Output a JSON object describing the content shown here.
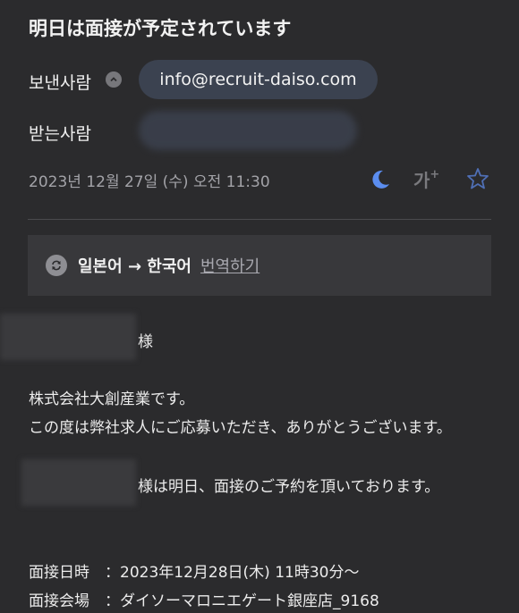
{
  "email": {
    "subject": "明日は面接が予定されています",
    "from_label": "보낸사람",
    "from_address": "info@recruit-daiso.com",
    "to_label": "받는사람",
    "date": "2023년 12월 27일 (수) 오전 11:30",
    "font_size_glyph": "가",
    "font_size_plus": "+"
  },
  "translate": {
    "text": "일본어 → 한국어",
    "link": "번역하기"
  },
  "body": {
    "salutation_suffix": "様",
    "line1": "株式会社大創産業です。",
    "line2": "この度は弊社求人にご応募いただき、ありがとうございます。",
    "line3": "様は明日、面接のご予約を頂いております。",
    "date_row": "面接日時　：2023年12月28日(木) 11時30分～",
    "venue_row": "面接会場　：ダイソーマロニエゲート銀座店_9168"
  },
  "colors": {
    "background": "#2b2b2d",
    "pill": "#3b4250",
    "moon": "#5b8def",
    "star": "#4f6fb5"
  }
}
